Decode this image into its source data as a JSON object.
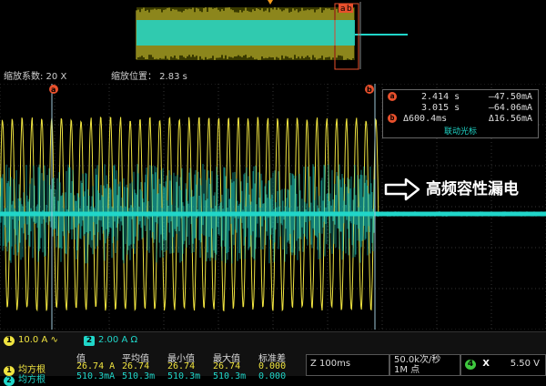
{
  "overview": {
    "cursor_a": "a",
    "cursor_b": "b"
  },
  "zoom": {
    "factor_label": "缩放系数: 20 X",
    "position_label": "缩放位置： 2.83 s"
  },
  "cursors": {
    "a": {
      "time": "2.414 s",
      "value": "–47.50mA"
    },
    "b": {
      "time": "3.015 s",
      "value": "–64.06mA"
    },
    "delta": {
      "time": "Δ600.4ms",
      "value": "Δ16.56mA"
    },
    "link_label": "联动光标"
  },
  "annotation": "高频容性漏电",
  "channels": [
    {
      "num": "1",
      "scale": "10.0 A",
      "suffix": "∿",
      "color": "#f0e440"
    },
    {
      "num": "2",
      "scale": "2.00 A",
      "suffix": "Ω",
      "color": "#20d6c9"
    }
  ],
  "measurements": {
    "headers": [
      "值",
      "平均值",
      "最小值",
      "最大值",
      "标准差"
    ],
    "rows": [
      {
        "ch": "1",
        "name": "均方根",
        "values": [
          "26.74 A",
          "26.74",
          "26.74",
          "26.74",
          "0.000"
        ],
        "color": "#f0e440"
      },
      {
        "ch": "2",
        "name": "均方根",
        "values": [
          "510.3mA",
          "510.3m",
          "510.3m",
          "510.3m",
          "0.000"
        ],
        "color": "#20d6c9"
      }
    ]
  },
  "timebase": {
    "scale": "Z 100ms"
  },
  "acquisition": {
    "rate": "50.0k次/秒",
    "points": "1M 点"
  },
  "trigger": {
    "channel": "4",
    "slope": "X",
    "level": "5.50 V"
  },
  "colors": {
    "ch1": "#f0e440",
    "ch2": "#20d6c9",
    "cursor": "#9ec7d8",
    "badge_red": "#e8502c"
  }
}
